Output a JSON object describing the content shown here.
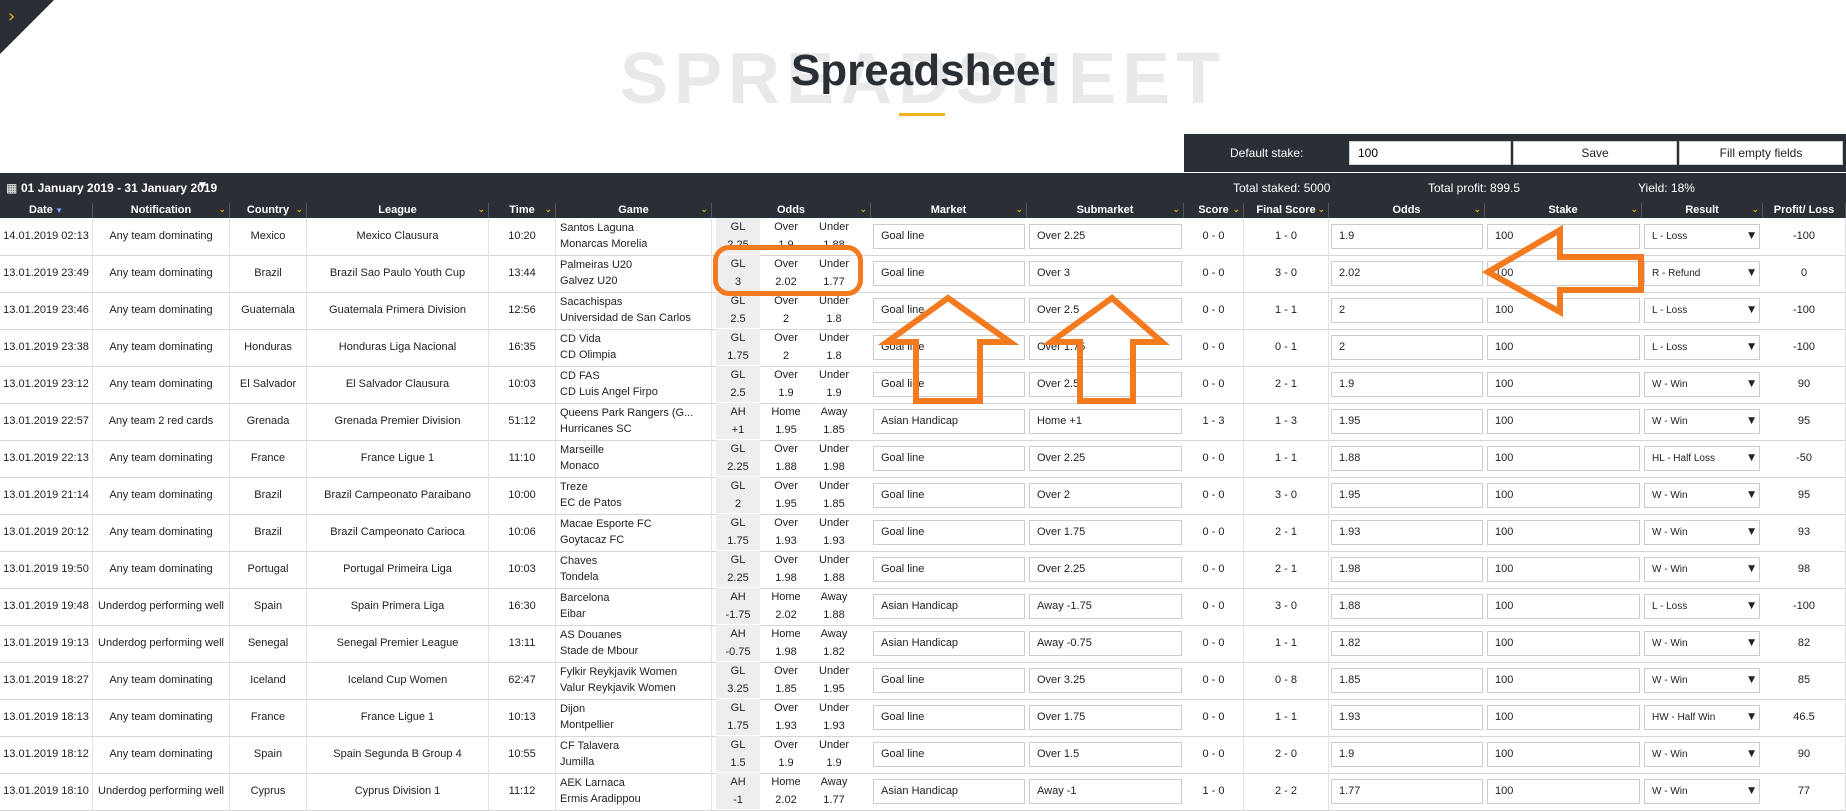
{
  "page": {
    "background_word": "SPREADSHEET",
    "title": "Spreadsheet",
    "accent": "#f2b21b"
  },
  "stake": {
    "label": "Default stake:",
    "value": "100",
    "save_label": "Save",
    "fill_label": "Fill empty fields"
  },
  "summary": {
    "date_range": "01 January 2019 - 31 January 2019",
    "total_staked": "Total staked: 5000",
    "total_profit": "Total profit: 899.5",
    "yield": "Yield: 18%"
  },
  "columns": [
    "Date",
    "Notification",
    "Country",
    "League",
    "Time",
    "Game",
    "Odds",
    "Market",
    "Submarket",
    "Score",
    "Final Score",
    "Odds",
    "Stake",
    "Result",
    "Profit/ Loss"
  ],
  "rows": [
    {
      "date": "14.01.2019 02:13",
      "notif": "Any team dominating",
      "country": "Mexico",
      "league": "Mexico Clausura",
      "time": "10:20",
      "home": "Santos Laguna",
      "away": "Monarcas Morelia",
      "oh": [
        "GL",
        "Over",
        "Under"
      ],
      "ov": [
        "2.25",
        "1.9",
        "1.88"
      ],
      "market": "Goal line",
      "sub": "Over 2.25",
      "score": "0 - 0",
      "final": "1 - 0",
      "odds": "1.9",
      "stake": "100",
      "result": "L - Loss",
      "pl": "-100"
    },
    {
      "date": "13.01.2019 23:49",
      "notif": "Any team dominating",
      "country": "Brazil",
      "league": "Brazil Sao Paulo Youth Cup",
      "time": "13:44",
      "home": "Palmeiras U20",
      "away": "Galvez U20",
      "oh": [
        "GL",
        "Over",
        "Under"
      ],
      "ov": [
        "3",
        "2.02",
        "1.77"
      ],
      "market": "Goal line",
      "sub": "Over 3",
      "score": "0 - 0",
      "final": "3 - 0",
      "odds": "2.02",
      "stake": "100",
      "result": "R - Refund",
      "pl": "0"
    },
    {
      "date": "13.01.2019 23:46",
      "notif": "Any team dominating",
      "country": "Guatemala",
      "league": "Guatemala Primera Division",
      "time": "12:56",
      "home": "Sacachispas",
      "away": "Universidad de San Carlos",
      "oh": [
        "GL",
        "Over",
        "Under"
      ],
      "ov": [
        "2.5",
        "2",
        "1.8"
      ],
      "market": "Goal line",
      "sub": "Over 2.5",
      "score": "0 - 0",
      "final": "1 - 1",
      "odds": "2",
      "stake": "100",
      "result": "L - Loss",
      "pl": "-100"
    },
    {
      "date": "13.01.2019 23:38",
      "notif": "Any team dominating",
      "country": "Honduras",
      "league": "Honduras Liga Nacional",
      "time": "16:35",
      "home": "CD Vida",
      "away": "CD Olimpia",
      "oh": [
        "GL",
        "Over",
        "Under"
      ],
      "ov": [
        "1.75",
        "2",
        "1.8"
      ],
      "market": "Goal line",
      "sub": "Over 1.75",
      "score": "0 - 0",
      "final": "0 - 1",
      "odds": "2",
      "stake": "100",
      "result": "L - Loss",
      "pl": "-100"
    },
    {
      "date": "13.01.2019 23:12",
      "notif": "Any team dominating",
      "country": "El Salvador",
      "league": "El Salvador Clausura",
      "time": "10:03",
      "home": "CD FAS",
      "away": "CD Luis Angel Firpo",
      "oh": [
        "GL",
        "Over",
        "Under"
      ],
      "ov": [
        "2.5",
        "1.9",
        "1.9"
      ],
      "market": "Goal line",
      "sub": "Over 2.5",
      "score": "0 - 0",
      "final": "2 - 1",
      "odds": "1.9",
      "stake": "100",
      "result": "W - Win",
      "pl": "90"
    },
    {
      "date": "13.01.2019 22:57",
      "notif": "Any team 2 red cards",
      "country": "Grenada",
      "league": "Grenada Premier Division",
      "time": "51:12",
      "home": "Queens Park Rangers (G...",
      "away": "Hurricanes SC",
      "oh": [
        "AH",
        "Home",
        "Away"
      ],
      "ov": [
        "+1",
        "1.95",
        "1.85"
      ],
      "market": "Asian Handicap",
      "sub": "Home +1",
      "score": "1 - 3",
      "final": "1 - 3",
      "odds": "1.95",
      "stake": "100",
      "result": "W - Win",
      "pl": "95"
    },
    {
      "date": "13.01.2019 22:13",
      "notif": "Any team dominating",
      "country": "France",
      "league": "France Ligue 1",
      "time": "11:10",
      "home": "Marseille",
      "away": "Monaco",
      "oh": [
        "GL",
        "Over",
        "Under"
      ],
      "ov": [
        "2.25",
        "1.88",
        "1.98"
      ],
      "market": "Goal line",
      "sub": "Over 2.25",
      "score": "0 - 0",
      "final": "1 - 1",
      "odds": "1.88",
      "stake": "100",
      "result": "HL - Half Loss",
      "pl": "-50"
    },
    {
      "date": "13.01.2019 21:14",
      "notif": "Any team dominating",
      "country": "Brazil",
      "league": "Brazil Campeonato Paraibano",
      "time": "10:00",
      "home": "Treze",
      "away": "EC de Patos",
      "oh": [
        "GL",
        "Over",
        "Under"
      ],
      "ov": [
        "2",
        "1.95",
        "1.85"
      ],
      "market": "Goal line",
      "sub": "Over 2",
      "score": "0 - 0",
      "final": "3 - 0",
      "odds": "1.95",
      "stake": "100",
      "result": "W - Win",
      "pl": "95"
    },
    {
      "date": "13.01.2019 20:12",
      "notif": "Any team dominating",
      "country": "Brazil",
      "league": "Brazil Campeonato Carioca",
      "time": "10:06",
      "home": "Macae Esporte FC",
      "away": "Goytacaz FC",
      "oh": [
        "GL",
        "Over",
        "Under"
      ],
      "ov": [
        "1.75",
        "1.93",
        "1.93"
      ],
      "market": "Goal line",
      "sub": "Over 1.75",
      "score": "0 - 0",
      "final": "2 - 1",
      "odds": "1.93",
      "stake": "100",
      "result": "W - Win",
      "pl": "93"
    },
    {
      "date": "13.01.2019 19:50",
      "notif": "Any team dominating",
      "country": "Portugal",
      "league": "Portugal Primeira Liga",
      "time": "10:03",
      "home": "Chaves",
      "away": "Tondela",
      "oh": [
        "GL",
        "Over",
        "Under"
      ],
      "ov": [
        "2.25",
        "1.98",
        "1.88"
      ],
      "market": "Goal line",
      "sub": "Over 2.25",
      "score": "0 - 0",
      "final": "2 - 1",
      "odds": "1.98",
      "stake": "100",
      "result": "W - Win",
      "pl": "98"
    },
    {
      "date": "13.01.2019 19:48",
      "notif": "Underdog performing well",
      "country": "Spain",
      "league": "Spain Primera Liga",
      "time": "16:30",
      "home": "Barcelona",
      "away": "Eibar",
      "oh": [
        "AH",
        "Home",
        "Away"
      ],
      "ov": [
        "-1.75",
        "2.02",
        "1.88"
      ],
      "market": "Asian Handicap",
      "sub": "Away -1.75",
      "score": "0 - 0",
      "final": "3 - 0",
      "odds": "1.88",
      "stake": "100",
      "result": "L - Loss",
      "pl": "-100"
    },
    {
      "date": "13.01.2019 19:13",
      "notif": "Underdog performing well",
      "country": "Senegal",
      "league": "Senegal Premier League",
      "time": "13:11",
      "home": "AS Douanes",
      "away": "Stade de Mbour",
      "oh": [
        "AH",
        "Home",
        "Away"
      ],
      "ov": [
        "-0.75",
        "1.98",
        "1.82"
      ],
      "market": "Asian Handicap",
      "sub": "Away -0.75",
      "score": "0 - 0",
      "final": "1 - 1",
      "odds": "1.82",
      "stake": "100",
      "result": "W - Win",
      "pl": "82"
    },
    {
      "date": "13.01.2019 18:27",
      "notif": "Any team dominating",
      "country": "Iceland",
      "league": "Iceland Cup Women",
      "time": "62:47",
      "home": "Fylkir Reykjavik Women",
      "away": "Valur Reykjavik Women",
      "oh": [
        "GL",
        "Over",
        "Under"
      ],
      "ov": [
        "3.25",
        "1.85",
        "1.95"
      ],
      "market": "Goal line",
      "sub": "Over 3.25",
      "score": "0 - 0",
      "final": "0 - 8",
      "odds": "1.85",
      "stake": "100",
      "result": "W - Win",
      "pl": "85"
    },
    {
      "date": "13.01.2019 18:13",
      "notif": "Any team dominating",
      "country": "France",
      "league": "France Ligue 1",
      "time": "10:13",
      "home": "Dijon",
      "away": "Montpellier",
      "oh": [
        "GL",
        "Over",
        "Under"
      ],
      "ov": [
        "1.75",
        "1.93",
        "1.93"
      ],
      "market": "Goal line",
      "sub": "Over 1.75",
      "score": "0 - 0",
      "final": "1 - 1",
      "odds": "1.93",
      "stake": "100",
      "result": "HW - Half Win",
      "pl": "46.5"
    },
    {
      "date": "13.01.2019 18:12",
      "notif": "Any team dominating",
      "country": "Spain",
      "league": "Spain Segunda B Group 4",
      "time": "10:55",
      "home": "CF Talavera",
      "away": "Jumilla",
      "oh": [
        "GL",
        "Over",
        "Under"
      ],
      "ov": [
        "1.5",
        "1.9",
        "1.9"
      ],
      "market": "Goal line",
      "sub": "Over 1.5",
      "score": "0 - 0",
      "final": "2 - 0",
      "odds": "1.9",
      "stake": "100",
      "result": "W - Win",
      "pl": "90"
    },
    {
      "date": "13.01.2019 18:10",
      "notif": "Underdog performing well",
      "country": "Cyprus",
      "league": "Cyprus Division 1",
      "time": "11:12",
      "home": "AEK Larnaca",
      "away": "Ermis Aradippou",
      "oh": [
        "AH",
        "Home",
        "Away"
      ],
      "ov": [
        "-1",
        "2.02",
        "1.77"
      ],
      "market": "Asian Handicap",
      "sub": "Away -1",
      "score": "1 - 0",
      "final": "2 - 2",
      "odds": "1.77",
      "stake": "100",
      "result": "W - Win",
      "pl": "77"
    }
  ]
}
